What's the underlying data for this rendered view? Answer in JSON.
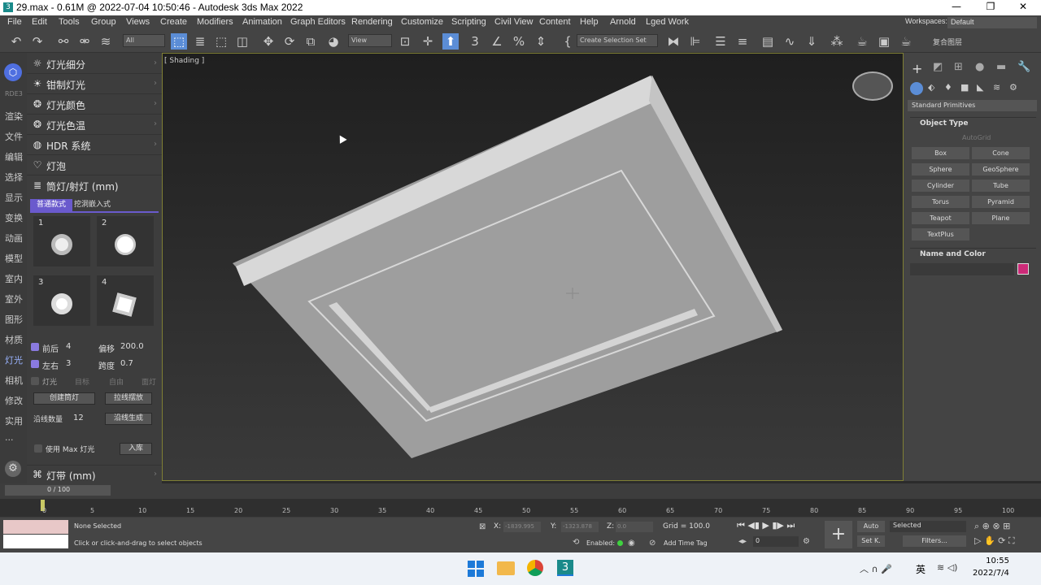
{
  "window": {
    "title": "29.max - 0.61M @ 2022-07-04 10:50:46 - Autodesk 3ds Max 2022",
    "minimize": "—",
    "maximize": "❐",
    "close": "✕"
  },
  "menu": [
    "File",
    "Edit",
    "Tools",
    "Group",
    "Views",
    "Create",
    "Modifiers",
    "Animation",
    "Graph Editors",
    "Rendering",
    "Customize",
    "Scripting",
    "Civil View",
    "Content",
    "Help",
    "Arnold",
    "Lged Work"
  ],
  "workspace": {
    "label": "Workspaces:",
    "value": "Default"
  },
  "toolbar": {
    "filter": "All",
    "refcoord": "View",
    "selset": "Create Selection Set",
    "extra": "复合图层"
  },
  "left_strip": [
    "渲染",
    "文件",
    "编辑",
    "选择",
    "显示",
    "变换",
    "动画",
    "模型",
    "室内",
    "室外",
    "图形",
    "材质",
    "灯光",
    "相机",
    "修改",
    "实用",
    "···"
  ],
  "left_strip_top": "RDE3",
  "left_panel": {
    "sections": [
      {
        "icon": "☼",
        "label": "灯光细分"
      },
      {
        "icon": "☀",
        "label": "钳制灯光"
      },
      {
        "icon": "❂",
        "label": "灯光颜色"
      },
      {
        "icon": "❂",
        "label": "灯光色温"
      },
      {
        "icon": "◍",
        "label": "HDR 系统"
      },
      {
        "icon": "♡",
        "label": "灯泡"
      }
    ],
    "downlight": {
      "label": "筒灯/射灯 (mm)",
      "tabs": [
        "普通款式",
        "挖洞嵌入式"
      ]
    },
    "thumbs": [
      "1",
      "2",
      "3",
      "4"
    ],
    "params": {
      "front_back_label": "前后",
      "front_back": "4",
      "offset_label": "偏移",
      "offset": "200.0",
      "left_right_label": "左右",
      "left_right": "3",
      "span_label": "跨度",
      "span": "0.7"
    },
    "radios": [
      "灯光",
      "目标",
      "自由",
      "面灯"
    ],
    "buttons": {
      "create": "创建筒灯",
      "line": "拉线摆放",
      "along_count_label": "沿线数量",
      "along_count": "12",
      "along_gen": "沿线生成",
      "use_max": "使用 Max 灯光",
      "store": "入库"
    },
    "strip_section": {
      "icon": "⌘",
      "label": "灯带 (mm)"
    }
  },
  "viewport": {
    "label": "[ Shading ]"
  },
  "right_panel": {
    "dropdown": "Standard Primitives",
    "object_type": "Object Type",
    "autogrid": "AutoGrid",
    "buttons": [
      "Box",
      "Cone",
      "Sphere",
      "GeoSphere",
      "Cylinder",
      "Tube",
      "Torus",
      "Pyramid",
      "Teapot",
      "Plane",
      "TextPlus"
    ],
    "name_color": "Name and Color",
    "swatch": "#cc2a78"
  },
  "timeline": {
    "frame": "0 / 100",
    "ticks": [
      "0",
      "5",
      "10",
      "15",
      "20",
      "25",
      "30",
      "35",
      "40",
      "45",
      "50",
      "55",
      "60",
      "65",
      "70",
      "75",
      "80",
      "85",
      "90",
      "95",
      "100"
    ]
  },
  "status": {
    "selected": "None Selected",
    "hint": "Click or click-and-drag to select objects",
    "x_label": "X:",
    "x": "-1839.995",
    "y_label": "Y:",
    "y": "-1323.878",
    "z_label": "Z:",
    "z": "0.0",
    "grid": "Grid = 100.0",
    "enabled": "Enabled:",
    "add_time_tag": "Add Time Tag",
    "auto": "Auto",
    "set_key": "Set K.",
    "selected_dd": "Selected",
    "filters": "Filters...",
    "frame_field": "0"
  },
  "taskbar": {
    "time": "10:55",
    "date": "2022/7/4",
    "lang": "英"
  }
}
